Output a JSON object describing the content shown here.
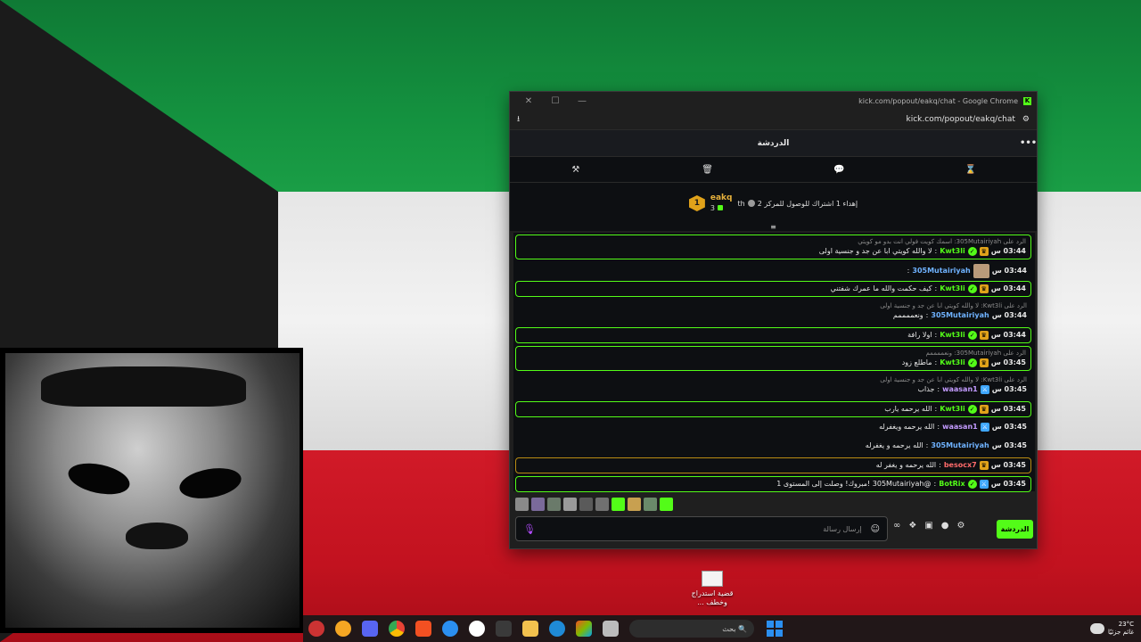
{
  "window": {
    "title": "kick.com/popout/eakq/chat - Google Chrome",
    "url": "kick.com/popout/eakq/chat"
  },
  "chat": {
    "header_title": "الدردشة",
    "more_icon": "ellipsis-icon",
    "toolbar_icons": [
      "hammer-icon",
      "trash-icon",
      "chat-bubble-icon",
      "hourglass-icon"
    ],
    "pinned": {
      "rank": "1",
      "username": "eakq",
      "count": "3",
      "goal_text": "إهداء 1 اشتراك للوصول للمركز 2",
      "goal_suffix": "th"
    },
    "messages": [
      {
        "reply": "الرد على 305Mutairiyah: اسمك كويت فولي انت بدو مو كويتي",
        "time": "03:44 س",
        "badges": [
          "crown",
          "verified"
        ],
        "user": "Kwt3li",
        "user_color": "#53fc18",
        "text": "لا والله كويتي ابا عن جد و جنسية اولى",
        "hl": "green"
      },
      {
        "reply": "",
        "time": "03:44 س",
        "badges": [
          "img"
        ],
        "user": "305Mutairiyah",
        "user_color": "#6fb2ff",
        "text": "",
        "hl": ""
      },
      {
        "reply": "",
        "time": "03:44 س",
        "badges": [
          "crown",
          "verified"
        ],
        "user": "Kwt3li",
        "user_color": "#53fc18",
        "text": "كيف حكمت والله ما عمرك شفتني",
        "hl": "green"
      },
      {
        "reply": "الرد على Kwt3li: لا والله كويتي ابا عن جد و جنسية اولى",
        "time": "03:44 س",
        "badges": [],
        "user": "305Mutairiyah",
        "user_color": "#6fb2ff",
        "text": "ونعممممم",
        "hl": ""
      },
      {
        "reply": "",
        "time": "03:44 س",
        "badges": [
          "crown",
          "verified"
        ],
        "user": "Kwt3li",
        "user_color": "#53fc18",
        "text": "اولا رافة",
        "hl": "green"
      },
      {
        "reply": "الرد على 305Mutairiyah: ونعممممم",
        "time": "03:45 س",
        "badges": [
          "crown",
          "verified"
        ],
        "user": "Kwt3li",
        "user_color": "#53fc18",
        "text": "ماطلع زود",
        "hl": "green"
      },
      {
        "reply": "الرد على Kwt3li: لا والله كويتي ابا عن جد و جنسية اولى",
        "time": "03:45 س",
        "badges": [
          "sub"
        ],
        "user": "waasan1",
        "user_color": "#c39bff",
        "text": "جذاب",
        "hl": ""
      },
      {
        "reply": "",
        "time": "03:45 س",
        "badges": [
          "crown",
          "verified"
        ],
        "user": "Kwt3li",
        "user_color": "#53fc18",
        "text": "الله يرحمه يارب",
        "hl": "green"
      },
      {
        "reply": "",
        "time": "03:45 س",
        "badges": [
          "sub"
        ],
        "user": "waasan1",
        "user_color": "#c39bff",
        "text": "الله يرحمه ويغفرله",
        "hl": ""
      },
      {
        "reply": "",
        "time": "03:45 س",
        "badges": [],
        "user": "305Mutairiyah",
        "user_color": "#6fb2ff",
        "text": "الله يرحمه و يغفرله",
        "hl": ""
      },
      {
        "reply": "",
        "time": "03:45 س",
        "badges": [
          "crown"
        ],
        "user": "besocx7",
        "user_color": "#ff6b6b",
        "text": "الله يرحمه و يغفر له",
        "hl": "yellow"
      },
      {
        "reply": "",
        "time": "03:45 س",
        "badges": [
          "sub",
          "verified"
        ],
        "user": "BotRix",
        "user_color": "#53fc18",
        "text": "@305Mutairiyah !مبروك! وصلت إلى المستوى 1",
        "hl": "green"
      }
    ],
    "input_placeholder": "إرسال رسالة",
    "send_label": "الدردشة"
  },
  "desktop_icon": {
    "label_line1": "قضية استدراج",
    "label_line2": "... وخطف"
  },
  "taskbar": {
    "search_placeholder": "بحث",
    "weather_temp": "23°C",
    "weather_desc": "غائم جزئيًا"
  },
  "colors": {
    "kick_green": "#53fc18",
    "chat_bg": "#0d0f12",
    "highlight_yellow": "#b98c13"
  }
}
